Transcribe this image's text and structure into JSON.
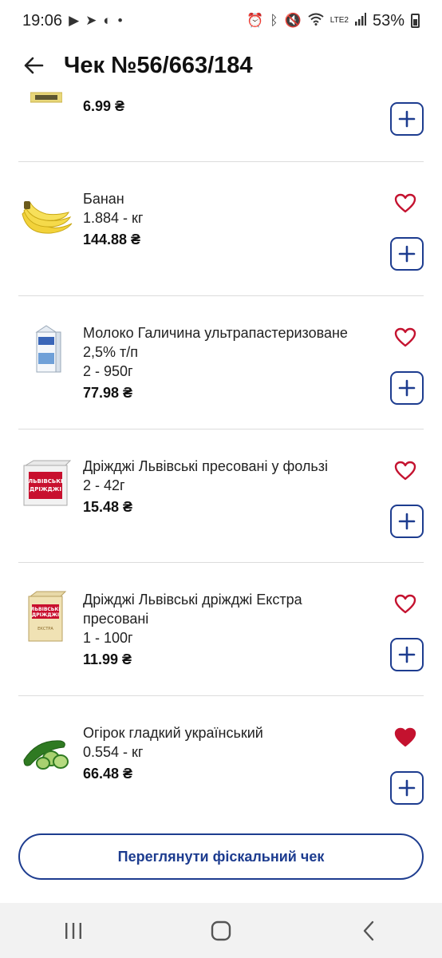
{
  "status_bar": {
    "time": "19:06",
    "battery": "53%",
    "network": "LTE2"
  },
  "header": {
    "title": "Чек №56/663/184"
  },
  "items": [
    {
      "name": "",
      "qty": "",
      "price": "6.99 ₴",
      "favorite": null
    },
    {
      "name": "Банан",
      "qty": "1.884 - кг",
      "price": "144.88 ₴",
      "favorite": false
    },
    {
      "name": "Молоко Галичина ультрапастеризоване 2,5% т/п",
      "qty": "2 - 950г",
      "price": "77.98 ₴",
      "favorite": false
    },
    {
      "name": "Дріжджі Львівські пресовані у фользі",
      "qty": "2 - 42г",
      "price": "15.48 ₴",
      "favorite": false
    },
    {
      "name": "Дріжджі Львівські дріжджі Екстра пресовані",
      "qty": "1 - 100г",
      "price": "11.99 ₴",
      "favorite": false
    },
    {
      "name": "Огірок гладкий український",
      "qty": "0.554 - кг",
      "price": "66.48 ₴",
      "favorite": true
    }
  ],
  "fiscal_button": {
    "label": "Переглянути фіскальний чек"
  },
  "colors": {
    "accent": "#1d3c8f",
    "heart": "#c4122f",
    "divider": "#dcdcdc"
  },
  "product_label_text": {
    "yeast_foil": "ЛЬВІВСЬКІ ДРІЖДЖІ",
    "yeast_extra": "ЛЬВІВСЬКІ ДРІЖДЖІ ЕКСТРА"
  }
}
